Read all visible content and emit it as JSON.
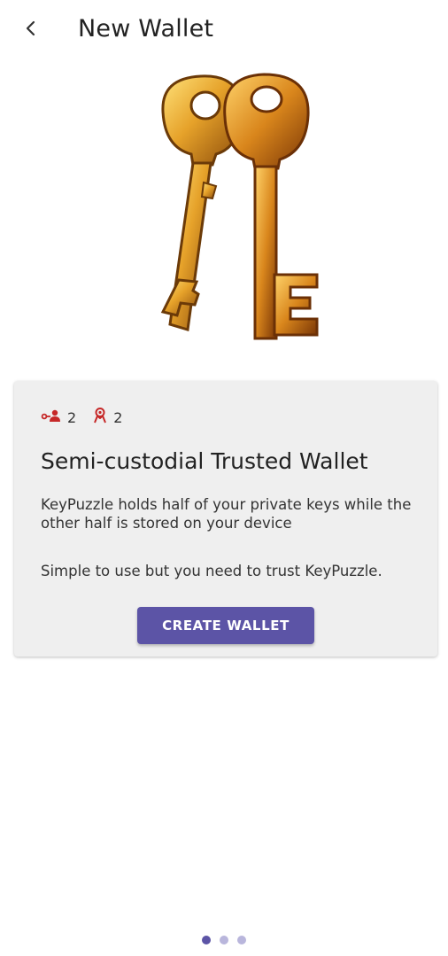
{
  "header": {
    "title": "New Wallet",
    "back_icon": "chevron-left-icon"
  },
  "hero": {
    "image": "golden-keys-illustration"
  },
  "card": {
    "stats": [
      {
        "icon": "user-key-icon",
        "value": "2"
      },
      {
        "icon": "person-keyhole-icon",
        "value": "2"
      }
    ],
    "title": "Semi-custodial Trusted Wallet",
    "description": "KeyPuzzle holds half of your private keys while the other half is stored on your device",
    "note": "Simple to use but you need to trust KeyPuzzle.",
    "button_label": "CREATE WALLET"
  },
  "pager": {
    "count": 3,
    "active": 1
  },
  "colors": {
    "accent": "#5c54a6",
    "icon_red": "#c62828",
    "card_bg": "#efefef"
  }
}
